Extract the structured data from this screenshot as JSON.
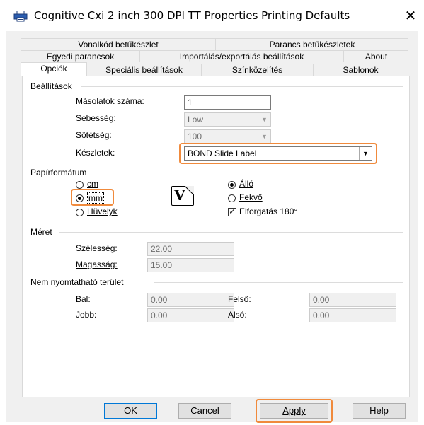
{
  "window": {
    "title": "Cognitive Cxi 2 inch 300 DPI TT Properties Printing Defaults",
    "close": "✕"
  },
  "tabs": {
    "row1": [
      "Vonalkód betűkészlet",
      "Parancs betűkészletek"
    ],
    "row2": [
      "Egyedi parancsok",
      "Importálás/exportálás beállítások",
      "About"
    ],
    "row3": [
      "Opciók",
      "Speciális beállítások",
      "Színközelítés",
      "Sablonok"
    ],
    "active": "Opciók"
  },
  "settings": {
    "group_label": "Beállítások",
    "copies_label": "Másolatok száma:",
    "copies_value": "1",
    "speed_label": "Sebesség:",
    "speed_value": "Low",
    "darkness_label": "Sötétség:",
    "darkness_value": "100",
    "stock_label": "Készletek:",
    "stock_value": "BOND Slide Label"
  },
  "paper_format": {
    "group_label": "Papírformátum",
    "units": {
      "cm": "cm",
      "mm": "mm",
      "inch": "Hüvelyk",
      "selected": "mm"
    },
    "orientation": {
      "portrait": "Álló",
      "landscape": "Fekvő",
      "selected": "Álló"
    },
    "rotate_label": "Elforgatás 180°",
    "rotate_checked": true,
    "preview_glyph": "V"
  },
  "size": {
    "group_label": "Méret",
    "width_label": "Szélesség:",
    "width_value": "22.00",
    "height_label": "Magasság:",
    "height_value": "15.00"
  },
  "unprintable": {
    "group_label": "Nem nyomtatható terület",
    "left_label": "Bal:",
    "left_value": "0.00",
    "top_label": "Felső:",
    "top_value": "0.00",
    "right_label": "Jobb:",
    "right_value": "0.00",
    "bottom_label": "Alsó:",
    "bottom_value": "0.00"
  },
  "buttons": {
    "ok": "OK",
    "cancel": "Cancel",
    "apply": "Apply",
    "help": "Help"
  },
  "colors": {
    "highlight": "#f08a3c",
    "panel_bg": "#f0f0f0",
    "default_button_border": "#0078d7"
  }
}
